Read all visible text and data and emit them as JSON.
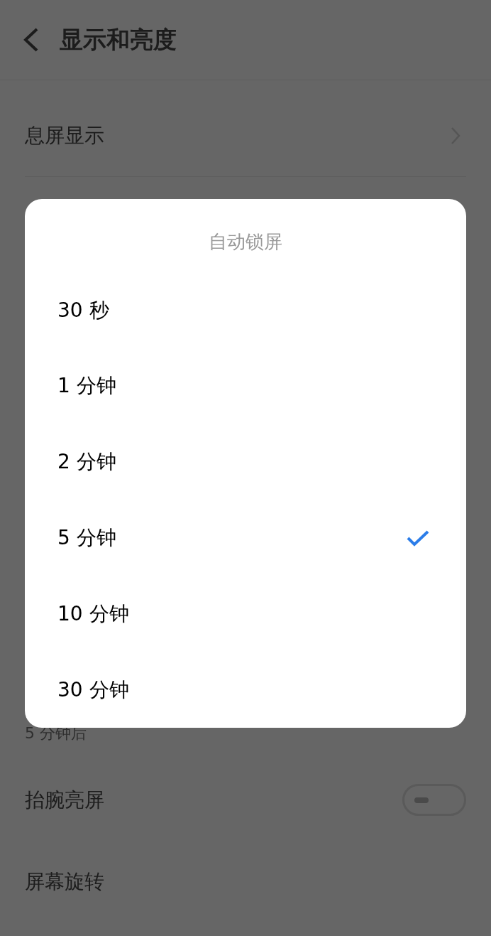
{
  "header": {
    "title": "显示和亮度"
  },
  "rows": [
    {
      "label": "息屏显示",
      "kind": "link"
    }
  ],
  "lower": {
    "summary": "5 分钟后",
    "rows": [
      {
        "label": "抬腕亮屏",
        "kind": "switch",
        "on": false
      },
      {
        "label": "屏幕旋转",
        "kind": "plain"
      }
    ]
  },
  "dialog": {
    "title": "自动锁屏",
    "options": [
      {
        "label": "30 秒",
        "selected": false
      },
      {
        "label": "1 分钟",
        "selected": false
      },
      {
        "label": "2 分钟",
        "selected": false
      },
      {
        "label": "5 分钟",
        "selected": true
      },
      {
        "label": "10 分钟",
        "selected": false
      },
      {
        "label": "30 分钟",
        "selected": false
      }
    ]
  }
}
